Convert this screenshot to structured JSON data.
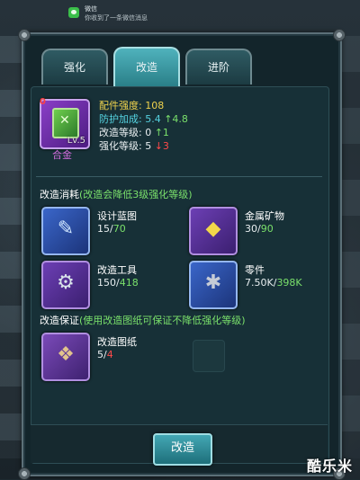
{
  "notification": {
    "app": "微信",
    "message": "你收到了一条微信消息",
    "icon": "wechat-icon"
  },
  "tabs": [
    {
      "label": "强化",
      "active": false
    },
    {
      "label": "改造",
      "active": true
    },
    {
      "label": "进阶",
      "active": false
    }
  ],
  "item": {
    "quantity": "0",
    "level": "Lv.5",
    "name": "合金",
    "icon": "alloy-armor-icon"
  },
  "stats": {
    "strength_label": "配件强度:",
    "strength_value": "108",
    "defense_label": "防护加成:",
    "defense_value": "5.4",
    "defense_delta": "↑4.8",
    "modify_label": "改造等级:",
    "modify_value": "0",
    "modify_delta": "↑1",
    "enhance_label": "强化等级:",
    "enhance_value": "5",
    "enhance_delta": "↓3"
  },
  "cost_section": {
    "label": "改造消耗",
    "note": "(改造会降低3级强化等级)"
  },
  "materials": [
    {
      "name": "设计蓝图",
      "have": "15",
      "need": "70",
      "icon": "blueprint-icon"
    },
    {
      "name": "金属矿物",
      "have": "30",
      "need": "90",
      "icon": "metal-ore-icon"
    },
    {
      "name": "改造工具",
      "have": "150",
      "need": "418",
      "icon": "tool-icon"
    },
    {
      "name": "零件",
      "have": "7.50K",
      "need": "398K",
      "icon": "parts-icon"
    }
  ],
  "guarantee_section": {
    "label": "改造保证",
    "note": "(使用改造图纸可保证不降低强化等级)"
  },
  "guarantee_item": {
    "name": "改造图纸",
    "have": "5",
    "need": "4",
    "icon": "scroll-icon"
  },
  "action_button": "改造",
  "watermark": "酷乐米",
  "colors": {
    "accent": "#4fb2bc",
    "stat_label": "#f0d34d",
    "bonus": "#55d3e0",
    "increase": "#7ae06b",
    "decrease": "#ff4a4a"
  }
}
